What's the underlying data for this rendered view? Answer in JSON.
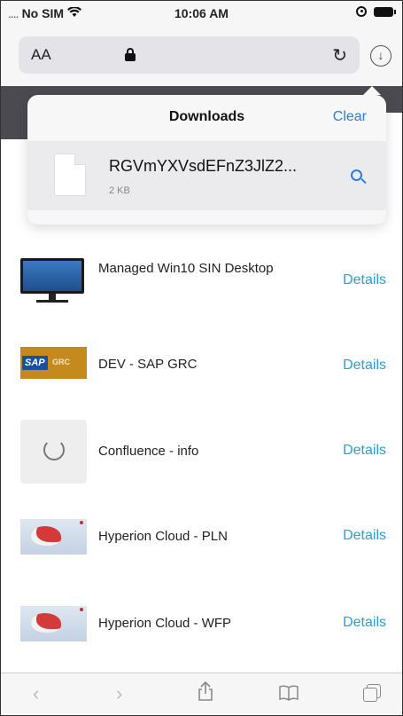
{
  "status_bar": {
    "carrier": "No SIM",
    "time": "10:06 AM"
  },
  "address_bar": {
    "reader_label": "AA"
  },
  "downloads": {
    "title": "Downloads",
    "clear_label": "Clear",
    "items": [
      {
        "file_name": "RGVmYXVsdEFnZ3JlZ2...",
        "size": "2 KB"
      }
    ]
  },
  "apps": [
    {
      "name": "Managed Win10 SIN Desktop",
      "action": "Details",
      "icon": "monitor-icon"
    },
    {
      "name": "DEV - SAP GRC",
      "action": "Details",
      "icon": "sap-grc-logo",
      "logo_text": "SAP",
      "logo_sub": "GRC"
    },
    {
      "name": "Confluence - info",
      "action": "Details",
      "icon": "confluence-icon"
    },
    {
      "name": "Hyperion Cloud - PLN",
      "action": "Details",
      "icon": "hyperion-cloud-icon"
    },
    {
      "name": "Hyperion Cloud - WFP",
      "action": "Details",
      "icon": "hyperion-cloud-icon"
    }
  ],
  "bottom_toolbar": {
    "back_icon": "chevron-left-icon",
    "forward_icon": "chevron-right-icon",
    "share_icon": "share-icon",
    "bookmarks_icon": "book-icon",
    "tabs_icon": "tabs-icon"
  },
  "colors": {
    "accent": "#2e9dcf",
    "link_blue": "#2a7de1",
    "sap_orange": "#c58a1e",
    "sap_blue": "#1a4fa0"
  }
}
